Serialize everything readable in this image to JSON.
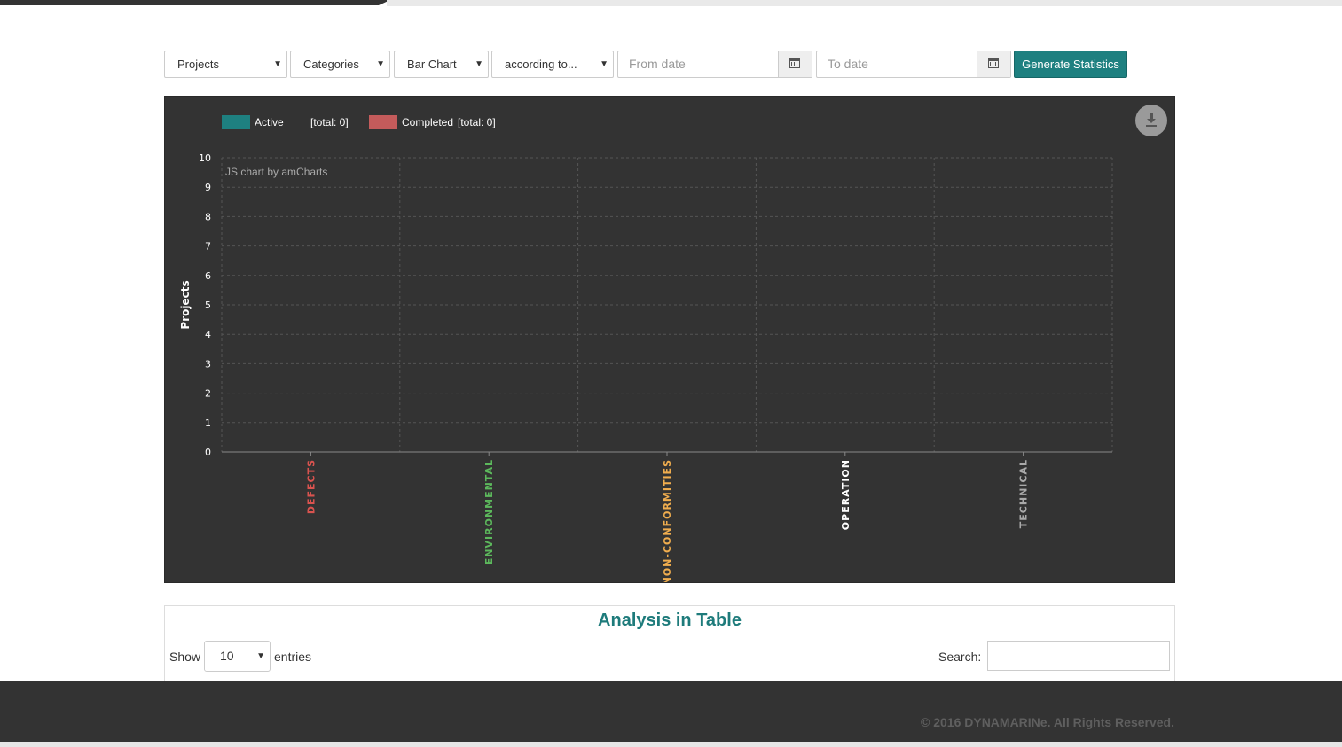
{
  "filters": {
    "type_select": "Projects",
    "group_select": "Categories",
    "chart_select": "Bar Chart",
    "according_select": "according to...",
    "from_date_placeholder": "From date",
    "to_date_placeholder": "To date",
    "generate_label": "Generate Statistics"
  },
  "chart_data": {
    "type": "bar",
    "categories": [
      "DEFECTS",
      "ENVIRONMENTAL",
      "NON-CONFORMITIES",
      "OPERATION",
      "TECHNICAL"
    ],
    "category_colors": [
      "#d9534f",
      "#5cb85c",
      "#f0ad4e",
      "#ffffff",
      "#aaaaaa"
    ],
    "series": [
      {
        "name": "Active",
        "total_label": "[total: 0]",
        "color": "#1e8080",
        "values": [
          0,
          0,
          0,
          0,
          0
        ]
      },
      {
        "name": "Completed",
        "total_label": "[total: 0]",
        "color": "#c45b5b",
        "values": [
          0,
          0,
          0,
          0,
          0
        ]
      }
    ],
    "ylabel": "Projects",
    "xlabel": "",
    "ylim": [
      0,
      10
    ],
    "y_ticks": [
      "0",
      "1",
      "2",
      "3",
      "4",
      "5",
      "6",
      "7",
      "8",
      "9",
      "10"
    ],
    "grid": true,
    "legend_position": "top-left",
    "credit": "JS chart by amCharts"
  },
  "table": {
    "title": "Analysis in Table",
    "show_label": "Show",
    "length_value": "10",
    "entries_label": "entries",
    "search_label": "Search:"
  },
  "footer": {
    "copyright": "© 2016 DYNAMARINe. All Rights Reserved."
  },
  "icons": [
    "calendar-icon",
    "download-icon",
    "chevron-down-icon"
  ]
}
